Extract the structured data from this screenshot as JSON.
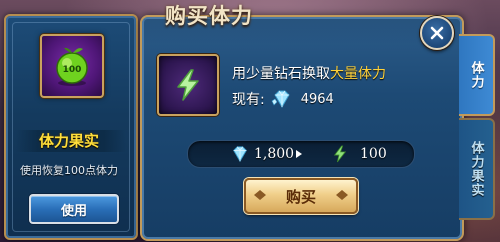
{
  "left_panel": {
    "item_name": "体力果实",
    "item_description": "使用恢复100点体力",
    "item_badge": "100",
    "use_button_label": "使用"
  },
  "dialog": {
    "title": "购买体力",
    "description_prefix": "用少量钻石换取",
    "description_highlight": "大量体力",
    "owned_label": "现有:",
    "owned_diamonds": "4964",
    "cost_diamonds": "1,800",
    "gain_stamina": "100",
    "buy_button_label": "购买"
  },
  "tabs": [
    {
      "label": "体力",
      "active": true
    },
    {
      "label": "体力果实",
      "active": false
    }
  ],
  "colors": {
    "highlight": "#ffd23a",
    "panel_blue": "#1d4a75",
    "gold_border": "#c29a5a"
  },
  "icons": {
    "item": "green-fruit-icon",
    "energy": "lightning-bolt-icon",
    "diamond": "diamond-icon",
    "close": "close-icon"
  }
}
